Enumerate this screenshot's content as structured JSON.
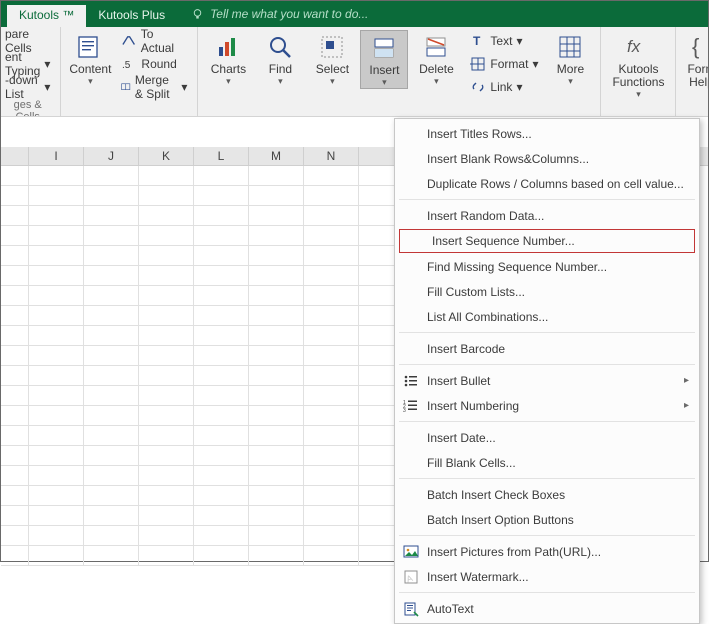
{
  "tabs": {
    "active": "Kutools ™",
    "second": "Kutools Plus"
  },
  "tell_me": "Tell me what you want to do...",
  "ribbon": {
    "group1": {
      "items": [
        "pare Cells",
        "ent Typing",
        "-down List"
      ],
      "label": "ges & Cells"
    },
    "content": {
      "btn": "Content",
      "to_actual": "To Actual",
      "round": "Round",
      "merge_split": "Merge & Split"
    },
    "charts": "Charts",
    "find": "Find",
    "select": "Select",
    "insert": "Insert",
    "delete": "Delete",
    "col_text": "Text",
    "col_format": "Format",
    "col_link": "Link",
    "more": "More",
    "kfunc": "Kutools\nFunctions",
    "fhelp": "Form\nHelp"
  },
  "columns": [
    "I",
    "J",
    "K",
    "L",
    "M",
    "N"
  ],
  "menu": [
    {
      "label": "Insert Titles Rows..."
    },
    {
      "label": "Insert Blank Rows&Columns..."
    },
    {
      "label": "Duplicate Rows / Columns based on cell value..."
    },
    {
      "sep": true
    },
    {
      "label": "Insert Random Data..."
    },
    {
      "label": "Insert Sequence Number...",
      "boxed": true
    },
    {
      "label": "Find Missing Sequence Number..."
    },
    {
      "label": "Fill Custom Lists..."
    },
    {
      "label": "List All Combinations..."
    },
    {
      "sep": true
    },
    {
      "label": "Insert Barcode"
    },
    {
      "sep": true
    },
    {
      "label": "Insert Bullet",
      "submenu": true,
      "icon": "bullet"
    },
    {
      "label": "Insert Numbering",
      "submenu": true,
      "icon": "numbering"
    },
    {
      "sep": true
    },
    {
      "label": "Insert Date..."
    },
    {
      "label": "Fill Blank Cells..."
    },
    {
      "sep": true
    },
    {
      "label": "Batch Insert Check Boxes"
    },
    {
      "label": "Batch Insert Option Buttons"
    },
    {
      "sep": true
    },
    {
      "label": "Insert Pictures from Path(URL)...",
      "icon": "picture"
    },
    {
      "label": "Insert Watermark...",
      "icon": "watermark"
    },
    {
      "sep": true
    },
    {
      "label": "AutoText",
      "icon": "autotext"
    }
  ]
}
